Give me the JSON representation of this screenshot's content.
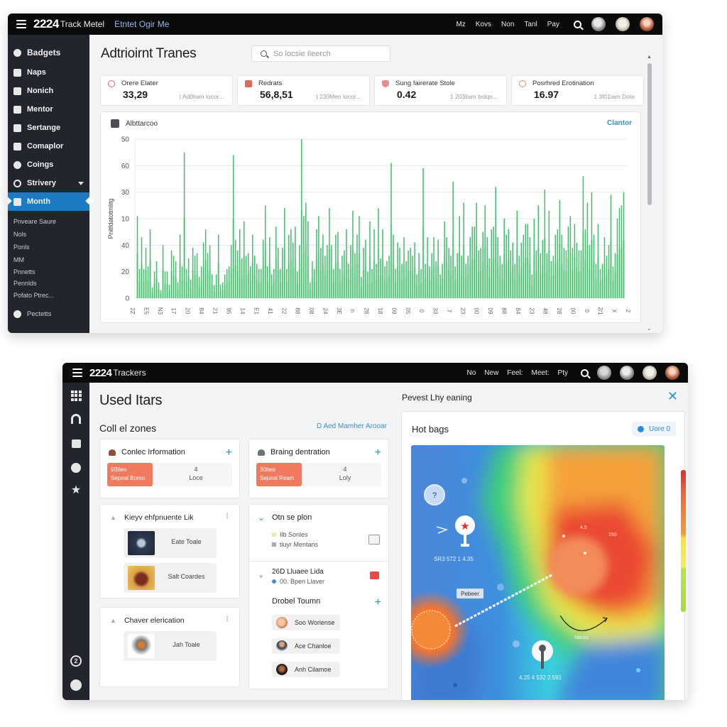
{
  "window1": {
    "brand_number": "2224",
    "brand_name": "Track Metel",
    "brand_sub": "Etntet Ogir Me",
    "top_links": [
      "Mz",
      "Kovs",
      "Non",
      "Tanl",
      "Pay"
    ],
    "sidebar": {
      "items": [
        {
          "label": "Badgets",
          "icon": "home-icon"
        },
        {
          "label": "Naps",
          "icon": "wrench-icon"
        },
        {
          "label": "Nonich",
          "icon": "panel-icon"
        },
        {
          "label": "Mentor",
          "icon": "document-icon"
        },
        {
          "label": "Sertange",
          "icon": "clock-icon"
        },
        {
          "label": "Comaplor",
          "icon": "inbox-icon"
        },
        {
          "label": "Coings",
          "icon": "bell-icon"
        },
        {
          "label": "Strivery",
          "icon": "settings-icon",
          "has_chevron": true
        },
        {
          "label": "Month",
          "icon": "folder-icon",
          "active": true
        }
      ],
      "sub_items": [
        "Pnveare Saure",
        "Nols",
        "Ponls",
        "MM",
        "Pnnetts",
        "Pennlds",
        "Pofato Ptrec..."
      ],
      "footer_item": {
        "label": "Pectetts",
        "icon": "location-icon"
      }
    },
    "page_title": "Adtrioirnt Tranes",
    "search": {
      "placeholder": "So locsie Ileerch",
      "value": ""
    },
    "stats": [
      {
        "label": "Orere Elater",
        "value": "33,29",
        "meta": "| Ad0liam locor...",
        "icon": "target-icon"
      },
      {
        "label": "Redrats",
        "value": "56,8,51",
        "meta": "| 230Men locor...",
        "icon": "house-icon"
      },
      {
        "label": "Sung fairerate Stole",
        "value": "0.42",
        "meta": "1 203liam bolqn...",
        "icon": "shield-icon"
      },
      {
        "label": "Posrhred Erotination",
        "value": "16.97",
        "meta": "1 3f01iam Dote",
        "icon": "drop-icon"
      }
    ],
    "chart_card": {
      "title": "Albttarcoo",
      "link_label": "Clantor"
    }
  },
  "chart_data": {
    "type": "bar",
    "title": "Albttarcoo",
    "xlabel": "",
    "ylabel": "Pnitfdatotmlitg",
    "y_tick_labels": [
      "0",
      "20",
      "40",
      "10",
      "30",
      "60",
      "50"
    ],
    "ylim_steps": [
      0,
      6
    ],
    "grid": true,
    "legend": "none",
    "x_tick_labels": [
      "2Z",
      "E5",
      "N3",
      "17",
      "20",
      "84",
      "21",
      "95",
      "14",
      "E1",
      "41",
      "22",
      "88",
      "08",
      "24",
      "3E",
      "n",
      "28",
      "18",
      "09",
      "05",
      "0",
      "33",
      "7",
      "23",
      "00",
      "09",
      "88",
      "84",
      "23",
      "48",
      "28",
      "00",
      "0",
      "2/1",
      "X",
      "2"
    ],
    "values_in_grid_steps": [
      3.1,
      1.1,
      2.3,
      1.1,
      1.9,
      1.2,
      2.6,
      0.4,
      1.0,
      1.4,
      0.6,
      0.3,
      2.0,
      1.0,
      1.0,
      0.5,
      1.8,
      1.6,
      1.4,
      0.6,
      2.4,
      1.2,
      5.5,
      1.1,
      1.5,
      0.7,
      1.9,
      1.6,
      1.7,
      0.8,
      1.2,
      2.1,
      2.6,
      1.7,
      2.0,
      0.9,
      0.5,
      0.9,
      2.4,
      0.5,
      0.6,
      0.9,
      1.1,
      1.2,
      2.0,
      5.4,
      2.2,
      1.8,
      2.6,
      1.5,
      2.9,
      1.6,
      1.7,
      1.2,
      2.4,
      1.6,
      1.3,
      1.1,
      1.1,
      2.2,
      3.5,
      1.2,
      2.3,
      0.9,
      1.1,
      2.7,
      1.9,
      1.1,
      1.9,
      3.4,
      1.1,
      2.4,
      2.6,
      2.1,
      2.7,
      1.0,
      2.0,
      6.0,
      3.1,
      3.6,
      2.9,
      0.6,
      1.4,
      1.1,
      2.6,
      3.1,
      1.9,
      2.4,
      1.6,
      2.0,
      3.4,
      2.0,
      1.1,
      2.4,
      2.5,
      1.1,
      1.6,
      1.8,
      2.6,
      1.3,
      2.0,
      3.3,
      1.7,
      2.4,
      3.1,
      0.8,
      1.9,
      2.2,
      1.0,
      2.9,
      1.1,
      2.6,
      1.3,
      3.4,
      1.5,
      2.6,
      1.2,
      1.4,
      1.6,
      5.1,
      2.4,
      1.1,
      2.1,
      1.9,
      1.3,
      2.3,
      1.4,
      1.8,
      1.9,
      1.6,
      2.1,
      0.9,
      1.7,
      1.1,
      4.9,
      1.3,
      2.3,
      1.2,
      1.7,
      2.3,
      1.4,
      2.2,
      0.9,
      1.3,
      2.9,
      2.3,
      1.9,
      1.6,
      4.4,
      1.2,
      1.7,
      3.1,
      1.6,
      3.6,
      1.3,
      1.6,
      2.3,
      2.7,
      2.7,
      3.6,
      1.8,
      1.9,
      2.5,
      3.5,
      2.3,
      1.5,
      2.6,
      2.7,
      4.2,
      2.3,
      1.6,
      1.3,
      3.0,
      2.4,
      2.6,
      1.8,
      2.1,
      1.3,
      3.3,
      1.6,
      2.1,
      2.4,
      2.8,
      2.8,
      2.3,
      0.9,
      3.0,
      1.8,
      3.5,
      1.7,
      2.2,
      4.1,
      1.7,
      3.3,
      1.4,
      1.6,
      2.4,
      2.6,
      3.7,
      2.4,
      1.9,
      1.8,
      2.7,
      3.1,
      1.9,
      2.8,
      2.1,
      1.8,
      1.8,
      4.6,
      2.6,
      3.6,
      2.0,
      4.0,
      2.4,
      1.3,
      2.8,
      1.1,
      1.3,
      2.3,
      1.6,
      2.0,
      3.9,
      1.2,
      1.7,
      3.0,
      3.4,
      3.5,
      4.0
    ]
  },
  "window2": {
    "brand_number": "2224",
    "brand_name": "Trackers",
    "top_links": [
      "No",
      "New",
      "Feel:",
      "Meet:",
      "Pty"
    ],
    "rail_icons": [
      "apps-grid-icon",
      "headset-icon",
      "inbox-icon",
      "pin-icon",
      "star-icon"
    ],
    "rail_footer_icons": [
      "user-circle-icon",
      "account-icon"
    ],
    "page_title": "Used Itars",
    "zones_title": "Coll el zones",
    "zones_link": "D Aed Mamher Arooar",
    "zone_cards": [
      {
        "title": "Conlec Irformation",
        "badge_line1": "9Btieo",
        "badge_line2": "Sepeal Bomo",
        "count": "4",
        "count_label": "Loce"
      },
      {
        "title": "Braing dentration",
        "badge_line1": "30tieo",
        "badge_line2": "Sepeal Ream",
        "count": "4",
        "count_label": "Loly"
      }
    ],
    "tool_cards": [
      {
        "title": "Kieyv ehfpnuente Lik",
        "tiles": [
          "Eate Toale",
          "Salt Coardes"
        ]
      },
      {
        "title": "Chaver elerication",
        "tiles": [
          "Jah Toale"
        ]
      }
    ],
    "options_card": {
      "title": "Otn se plon",
      "sub1": "Ilb Sonles",
      "sub2": "tiuyr Mentans",
      "row2_title": "26D Lluaee Lida",
      "row2_sub": "00. Bpen Llaver",
      "team_title": "Drobel Toumn",
      "members": [
        "Soo Worlense",
        "Ace Chanloe",
        "Anh Cilamoe"
      ]
    },
    "right_panel": {
      "title": "Pevest Lhy eaning",
      "card_title": "Hot bags",
      "button_label": "Uore 0",
      "map_labels": {
        "coords_top": "SR3 572 1 4.35",
        "coords_bottom": "4.25 4 532 2.591",
        "tag": "Pebeer",
        "arrow_label": "Nanss",
        "value_a": "4.5",
        "value_b": "150"
      }
    }
  }
}
